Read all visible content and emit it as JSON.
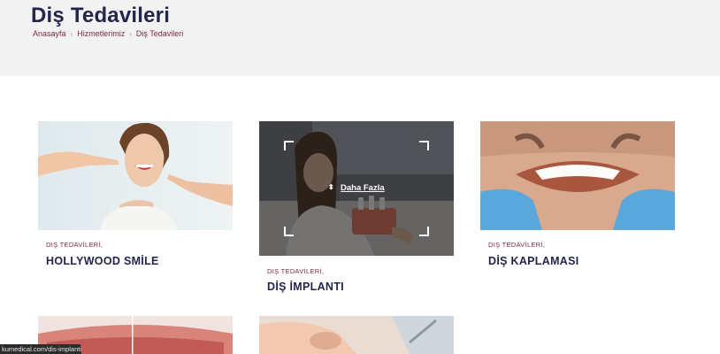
{
  "header": {
    "title": "Diş Tedavileri",
    "breadcrumb": [
      "Anasayfa",
      "Hizmetlerimiz",
      "Diş Tedavileri"
    ]
  },
  "cards": [
    {
      "category": "DIŞ TEDAVİLERİ,",
      "title": "HOLLYWOOD SMİLE"
    },
    {
      "category": "DIŞ TEDAVİLERİ,",
      "title": "DİŞ İMPLANTI",
      "hover_label": "Daha Fazla"
    },
    {
      "category": "DIŞ TEDAVİLERİ,",
      "title": "DİŞ KAPLAMASI"
    }
  ],
  "status_bar": {
    "url": "kumedical.com/dis-implanti"
  }
}
